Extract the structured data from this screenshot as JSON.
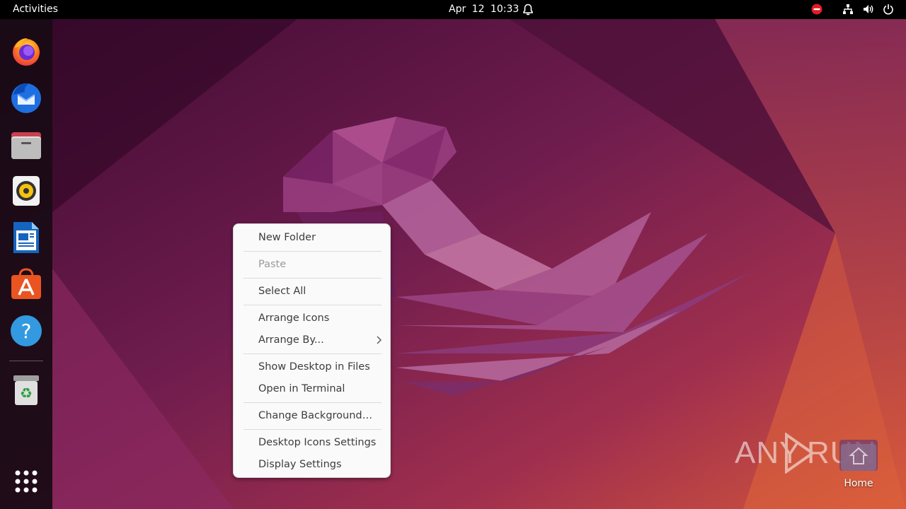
{
  "topbar": {
    "activities_label": "Activities",
    "clock_text": "Apr 12  10:33",
    "bell_icon": "bell-icon",
    "tray_icons": [
      "stop-icon",
      "network-icon",
      "volume-icon",
      "power-icon"
    ]
  },
  "dock": {
    "apps": [
      {
        "name": "Firefox",
        "icon": "firefox-icon"
      },
      {
        "name": "Thunderbird",
        "icon": "thunderbird-icon"
      },
      {
        "name": "Files",
        "icon": "files-icon"
      },
      {
        "name": "Rhythmbox",
        "icon": "rhythmbox-icon"
      },
      {
        "name": "LibreOffice Writer",
        "icon": "writer-icon"
      },
      {
        "name": "Ubuntu Software",
        "icon": "software-icon"
      },
      {
        "name": "Help",
        "icon": "help-icon"
      },
      {
        "name": "Trash",
        "icon": "trash-icon"
      }
    ],
    "show_apps_icon": "app-grid-icon"
  },
  "context_menu": {
    "items": [
      {
        "label": "New Folder",
        "enabled": true
      },
      {
        "label": "Paste",
        "enabled": false
      },
      {
        "label": "Select All",
        "enabled": true
      },
      {
        "label": "Arrange Icons",
        "enabled": true
      },
      {
        "label": "Arrange By...",
        "enabled": true,
        "submenu": true
      },
      {
        "label": "Show Desktop in Files",
        "enabled": true
      },
      {
        "label": "Open in Terminal",
        "enabled": true
      },
      {
        "label": "Change Background…",
        "enabled": true
      },
      {
        "label": "Desktop Icons Settings",
        "enabled": true
      },
      {
        "label": "Display Settings",
        "enabled": true
      }
    ]
  },
  "desktop": {
    "home_label": "Home"
  },
  "watermark": {
    "left_text": "ANY",
    "right_text": "RUN"
  },
  "colors": {
    "topbar": "#000000",
    "menu_bg": "#fafafa",
    "menu_text": "#3d3d3d",
    "menu_disabled": "#9a9a9a",
    "wallpaper_dark": "#3a0a2e",
    "wallpaper_light": "#d0543c"
  }
}
